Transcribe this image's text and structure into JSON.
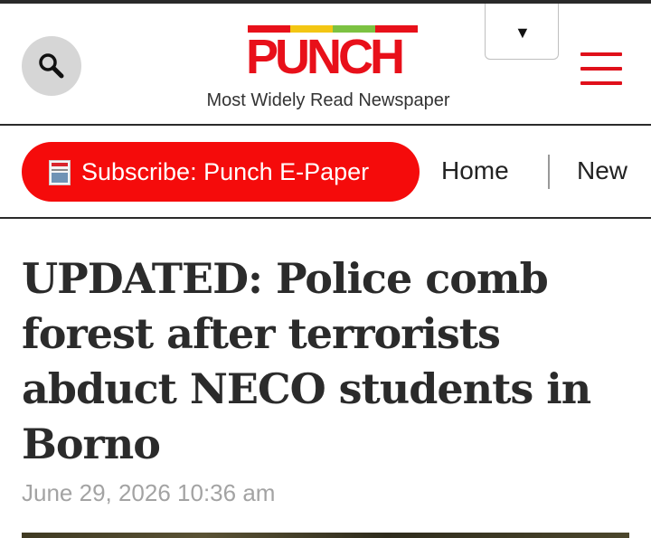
{
  "header": {
    "search_icon": "search-icon",
    "logo_text": "PUNCH",
    "logo_stripe_colors": [
      "#e8101a",
      "#f3c613",
      "#7cc242",
      "#e8101a"
    ],
    "tagline": "Most Widely Read Newspaper",
    "language_dropdown_icon": "triangle-down-icon",
    "menu_icon": "hamburger-menu-icon",
    "accent_color": "#e0101a"
  },
  "navbar": {
    "subscribe_label": "Subscribe: Punch E-Paper",
    "subscribe_icon": "epaper-thumbnail-icon",
    "subscribe_color": "#f50b0b",
    "links": [
      {
        "label": "Home"
      },
      {
        "label": "New"
      }
    ]
  },
  "article": {
    "headline": "UPDATED: Police comb forest after terrorists abduct NECO students in Borno",
    "date": "June 29, 2026 10:36 am"
  }
}
